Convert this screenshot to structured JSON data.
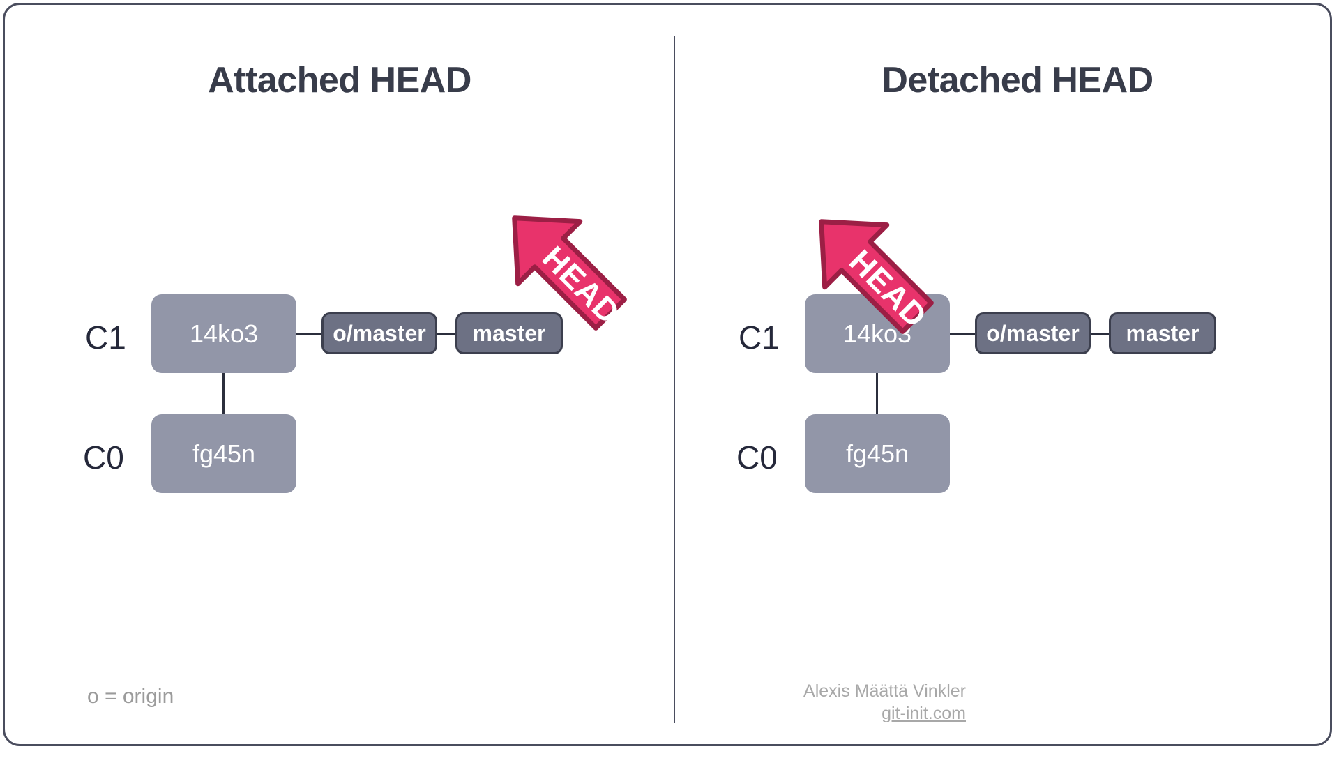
{
  "card": {
    "border_color": "#4a4d5e",
    "background": "#ffffff"
  },
  "colors": {
    "title": "#383c4a",
    "commit_fill": "#9296a8",
    "ref_fill": "#6d7184",
    "ref_border": "#3c3f4e",
    "connector": "#2b2e3c",
    "head_fill": "#e8336b",
    "head_border": "#9c1f45",
    "head_text": "#ffffff",
    "footer_text": "#a8a8a8",
    "legend_text": "#9b9b9b",
    "divider": "#4a4d5e"
  },
  "panels": [
    {
      "id": "attached",
      "title": "Attached HEAD",
      "rows": [
        {
          "label": "C1",
          "commit": "14ko3"
        },
        {
          "label": "C0",
          "commit": "fg45n"
        }
      ],
      "refs": [
        "o/master",
        "master"
      ],
      "head": {
        "label": "HEAD",
        "points_at": "master"
      }
    },
    {
      "id": "detached",
      "title": "Detached HEAD",
      "rows": [
        {
          "label": "C1",
          "commit": "14ko3"
        },
        {
          "label": "C0",
          "commit": "fg45n"
        }
      ],
      "refs": [
        "o/master",
        "master"
      ],
      "head": {
        "label": "HEAD",
        "points_at": "14ko3"
      }
    }
  ],
  "legend": "o = origin",
  "credit": {
    "author": "Alexis Määttä Vinkler",
    "site": "git-init.com"
  }
}
